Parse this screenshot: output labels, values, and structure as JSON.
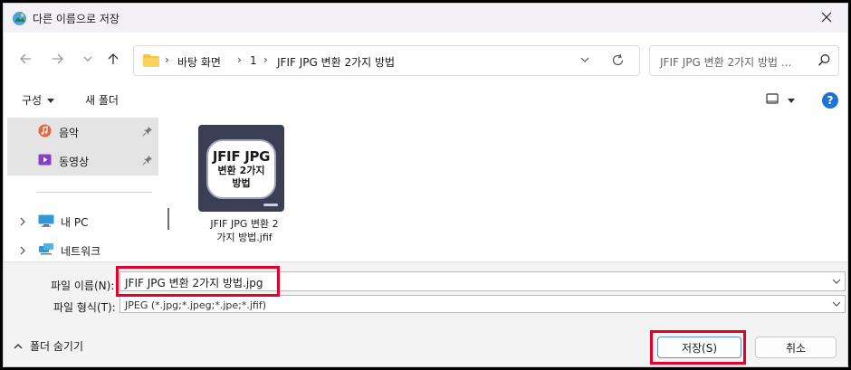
{
  "window": {
    "title": "다른 이름으로 저장",
    "app_icon": "photos-app-icon",
    "close_icon": "close-icon"
  },
  "navigation": {
    "back_icon": "back-arrow-icon",
    "forward_icon": "forward-arrow-icon",
    "recent_icon": "chevron-down-icon",
    "up_icon": "up-arrow-icon",
    "breadcrumbs": [
      "바탕 화면",
      "1",
      "JFIF JPG 변환 2가지 방법"
    ],
    "search_placeholder": "JFIF JPG 변환 2가지 방법 ..."
  },
  "toolbar": {
    "organize_label": "구성",
    "new_folder_label": "새 폴더",
    "help_label": "?"
  },
  "sidebar": {
    "quick_access": [
      {
        "label": "음악",
        "icon": "music-icon",
        "pinned": true,
        "selected": true
      },
      {
        "label": "동영상",
        "icon": "video-icon",
        "pinned": true,
        "selected": true
      }
    ],
    "tree": [
      {
        "label": "내 PC",
        "icon": "pc-icon"
      },
      {
        "label": "네트워크",
        "icon": "network-icon"
      }
    ]
  },
  "files": [
    {
      "name": "JFIF JPG 변환 2가지 방법.jfif",
      "name_lines": [
        "JFIF JPG 변환 2",
        "가지 방법.jfif"
      ],
      "thumbnail_text": [
        "JFIF JPG",
        "변환 2가지",
        "방법"
      ]
    }
  ],
  "form": {
    "filename_label": "파일 이름(N):",
    "filename_value": "JFIF JPG 변환 2가지 방법.jpg",
    "filetype_label": "파일 형식(T):",
    "filetype_value": "JPEG (*.jpg;*.jpeg;*.jpe;*.jfif)"
  },
  "footer": {
    "hide_folders_label": "폴더 숨기기",
    "save_label": "저장(S)",
    "cancel_label": "취소"
  },
  "colors": {
    "accent": "#1f74d2",
    "highlight_box": "#e4002b",
    "title_bar": "#f3f1f5",
    "footer_bg": "#f3f3f3"
  }
}
